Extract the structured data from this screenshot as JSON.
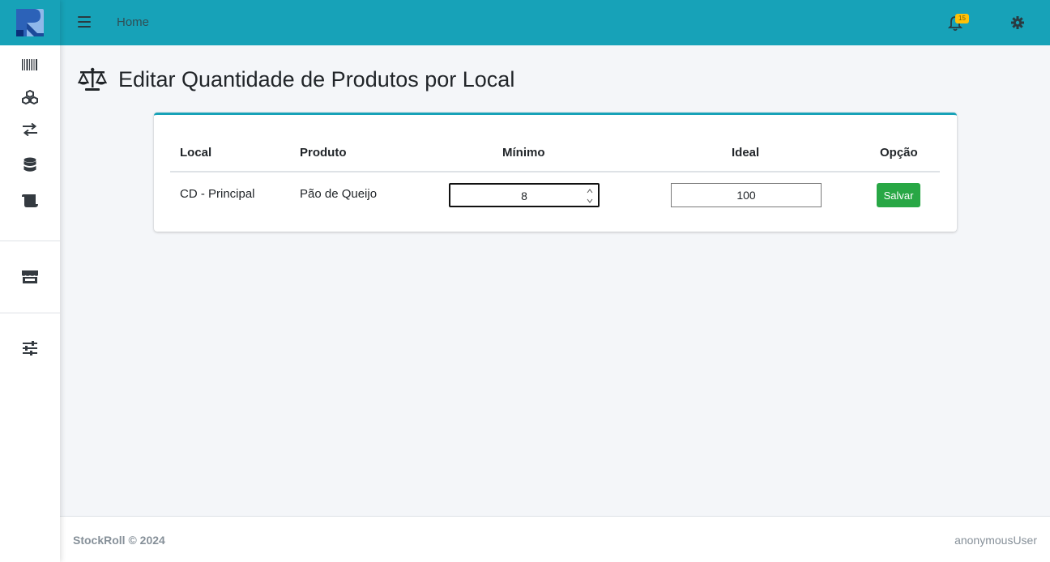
{
  "app": {
    "brand_color": "#17a2b8",
    "accent_success": "#28a745",
    "badge_color": "#ffc107"
  },
  "sidebar": {
    "items": [
      {
        "icon": "barcode-icon"
      },
      {
        "icon": "cubes-icon"
      },
      {
        "icon": "exchange-arrows-icon"
      },
      {
        "icon": "database-icon"
      },
      {
        "icon": "scroll-icon"
      },
      {
        "icon": "store-icon"
      },
      {
        "icon": "sliders-icon"
      }
    ]
  },
  "topbar": {
    "menu_icon": "hamburger-icon",
    "home_label": "Home",
    "notifications_count": "15",
    "settings_icon": "gear-icon"
  },
  "page": {
    "title": "Editar Quantidade de Produtos por Local",
    "title_icon": "balance-scale-icon"
  },
  "table": {
    "headers": {
      "local": "Local",
      "produto": "Produto",
      "minimo": "Mínimo",
      "ideal": "Ideal",
      "opcao": "Opção"
    },
    "rows": [
      {
        "local": "CD - Principal",
        "produto": "Pão de Queijo",
        "minimo": "8",
        "ideal": "100",
        "action_label": "Salvar"
      }
    ]
  },
  "footer": {
    "copyright": "StockRoll © 2024",
    "user": "anonymousUser"
  }
}
